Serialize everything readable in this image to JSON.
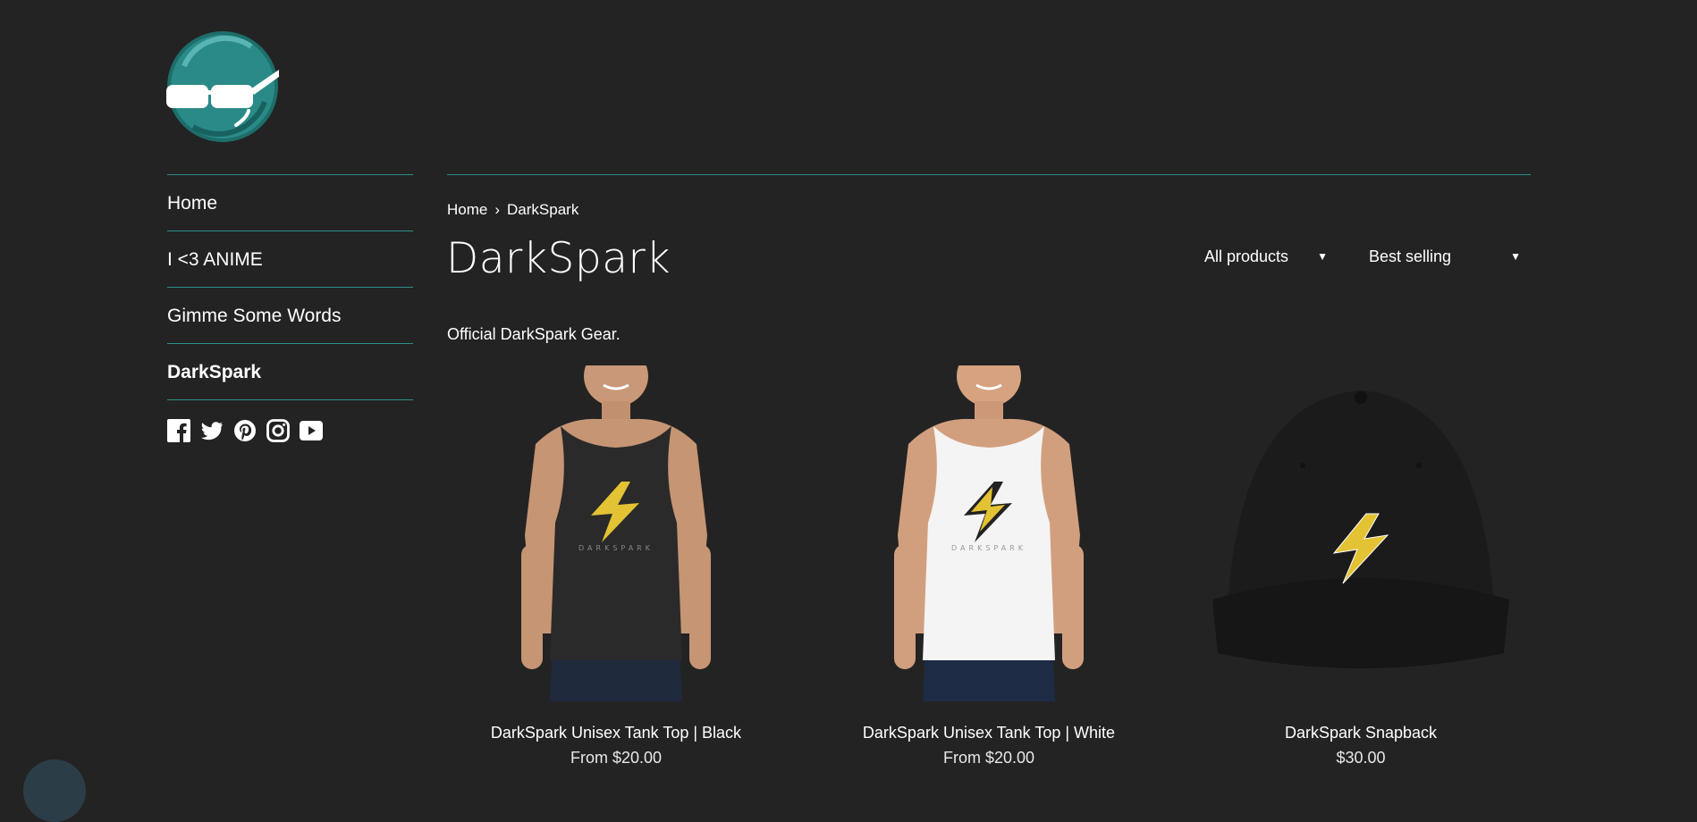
{
  "store": {
    "logo_icon": "sunglasses-face-logo-icon",
    "colors": {
      "background": "#232323",
      "accent": "#2d8f8c",
      "text": "#ffffff"
    }
  },
  "sidebar": {
    "items": [
      {
        "label": "Home",
        "active": false
      },
      {
        "label": "I <3 ANIME",
        "active": false
      },
      {
        "label": "Gimme Some Words",
        "active": false
      },
      {
        "label": "DarkSpark",
        "active": true
      }
    ],
    "social": [
      "facebook-icon",
      "twitter-icon",
      "pinterest-icon",
      "instagram-icon",
      "youtube-icon"
    ]
  },
  "breadcrumb": {
    "home": "Home",
    "separator": "›",
    "current": "DarkSpark"
  },
  "collection": {
    "title": "DarkSpark",
    "description": "Official DarkSpark Gear.",
    "filter_value": "All products",
    "sort_value": "Best selling"
  },
  "products": [
    {
      "title": "DarkSpark Unisex Tank Top | Black",
      "price": "From $20.00"
    },
    {
      "title": "DarkSpark Unisex Tank Top | White",
      "price": "From $20.00"
    },
    {
      "title": "DarkSpark Snapback",
      "price": "$30.00"
    }
  ]
}
